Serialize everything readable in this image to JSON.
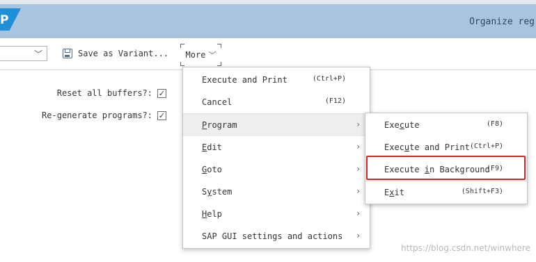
{
  "shell": {
    "logo_text": "P",
    "title": "Organize reg"
  },
  "toolbar": {
    "variant_select_value": "",
    "save_variant_label": "Save as Variant...",
    "more_label": "More"
  },
  "params": [
    {
      "label": "Reset all buffers?:",
      "checked": true,
      "mark": "✓"
    },
    {
      "label": "Re-generate programs?:",
      "checked": true,
      "mark": "✓"
    }
  ],
  "menu": {
    "items": [
      {
        "label": "Execute and Print",
        "shortcut": "(Ctrl+P)"
      },
      {
        "label": "Cancel",
        "shortcut": "(F12)"
      },
      {
        "pre": "",
        "ul": "P",
        "post": "rogram",
        "submenu": true,
        "selected": true
      },
      {
        "pre": "",
        "ul": "E",
        "post": "dit",
        "submenu": true
      },
      {
        "pre": "",
        "ul": "G",
        "post": "oto",
        "submenu": true
      },
      {
        "pre": "S",
        "ul": "y",
        "post": "stem",
        "submenu": true
      },
      {
        "pre": "",
        "ul": "H",
        "post": "elp",
        "submenu": true
      },
      {
        "label": "SAP GUI settings and actions",
        "submenu": true
      }
    ],
    "arrow": "›"
  },
  "submenu": {
    "items": [
      {
        "pre": "Exe",
        "ul": "c",
        "post": "ute",
        "shortcut": "(F8)"
      },
      {
        "pre": "Exec",
        "ul": "u",
        "post": "te and Print",
        "shortcut": "(Ctrl+P)"
      },
      {
        "pre": "Execute ",
        "ul": "i",
        "post": "n Background",
        "shortcut": "(F9)",
        "highlighted": true
      },
      {
        "pre": "E",
        "ul": "x",
        "post": "it",
        "shortcut": "(Shift+F3)"
      }
    ]
  },
  "watermark": "https://blog.csdn.net/winwhere",
  "icons": {
    "chevron": "chevron-down-icon",
    "save": "save-icon"
  },
  "colors": {
    "shell_bar": "#a9c4dd",
    "highlight": "#e02020",
    "logo": "#1f8fd8"
  }
}
